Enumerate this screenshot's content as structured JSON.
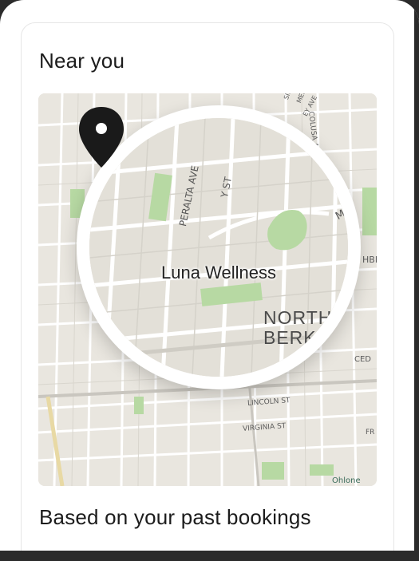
{
  "section_near": {
    "title": "Near you"
  },
  "map": {
    "place_name": "Luna Wellness",
    "district_line1": "NORTH",
    "district_line2": "BERKELEY",
    "streets": {
      "peralta": "PERALTA AVE",
      "st_partial": "Y ST",
      "sierra": "SIERRA",
      "mercer": "MERCER",
      "key_ave": "EY AVE",
      "colusa": "COLUSA AVE",
      "mo": "MO",
      "hbi": "HBI",
      "ced": "CED",
      "lincoln": "LINCOLN ST",
      "virginia": "VIRGINIA ST",
      "fr": "FR"
    },
    "credit": "Ohlone",
    "colors": {
      "land": "#e9e6df",
      "road": "#ffffff",
      "park": "#b7d9a3",
      "pin": "#1a1a1a"
    },
    "icons": {
      "pin": "map-pin-icon"
    }
  },
  "section_past": {
    "title": "Based on your past bookings"
  }
}
